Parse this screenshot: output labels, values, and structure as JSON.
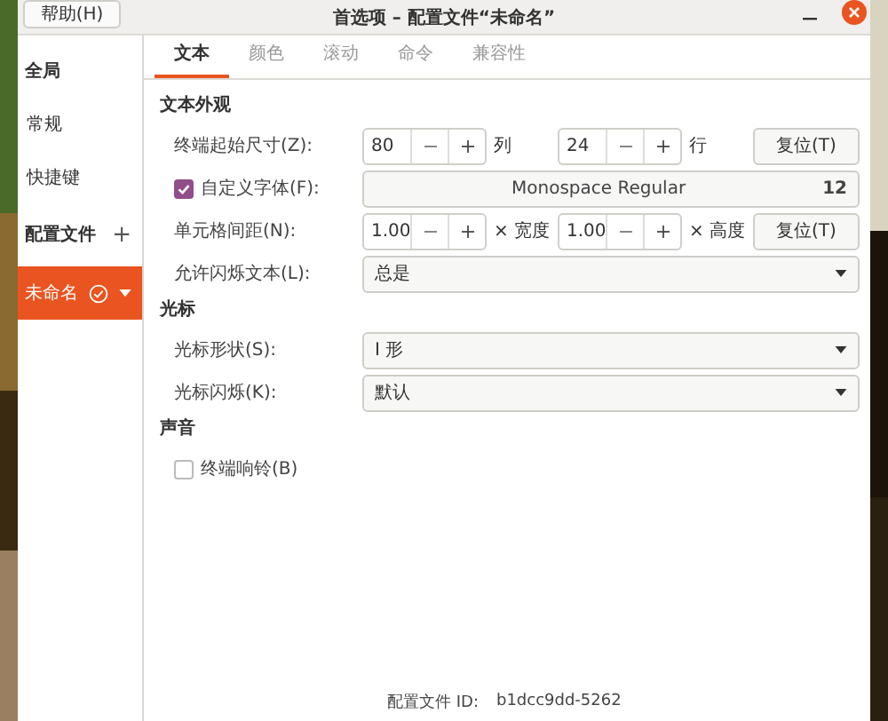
{
  "window": {
    "title": "首选项 – 配置文件“未命名”",
    "help_button": "帮助(H)"
  },
  "sidebar": {
    "items": [
      {
        "kind": "header",
        "label": "全局",
        "selected": false
      },
      {
        "kind": "item",
        "label": "常规",
        "selected": false
      },
      {
        "kind": "item",
        "label": "快捷键",
        "selected": false
      },
      {
        "kind": "header_add",
        "label": "配置文件",
        "add": "+",
        "selected": false
      },
      {
        "kind": "profile",
        "label": "未命名",
        "selected": true
      }
    ]
  },
  "tabs": [
    {
      "label": "文本",
      "selected": true
    },
    {
      "label": "颜色",
      "selected": false
    },
    {
      "label": "滚动",
      "selected": false
    },
    {
      "label": "命令",
      "selected": false
    },
    {
      "label": "兼容性",
      "selected": false
    }
  ],
  "sections": [
    {
      "title": "文本外观",
      "rows": [
        {
          "kind": "size",
          "label": "终端起始尺寸(Z):",
          "a": "80",
          "a_unit": "列",
          "b": "24",
          "b_unit": "行",
          "reset": "复位(T)"
        },
        {
          "kind": "font",
          "label": "自定义字体(F):",
          "checked": true,
          "font": "Monospace Regular",
          "size": "12"
        },
        {
          "kind": "size",
          "label": "单元格间距(N):",
          "a": "1.00",
          "a_unit": "× 宽度",
          "b": "1.00",
          "b_unit": "× 高度",
          "reset": "复位(T)"
        },
        {
          "kind": "select",
          "label": "允许闪烁文本(L):",
          "value": "总是"
        }
      ]
    },
    {
      "title": "光标",
      "rows": [
        {
          "kind": "select",
          "label": "光标形状(S):",
          "value": "I 形"
        },
        {
          "kind": "select",
          "label": "光标闪烁(K):",
          "value": "默认"
        }
      ]
    },
    {
      "title": "声音",
      "rows": [
        {
          "kind": "check",
          "label": "终端响铃(B)",
          "checked": false
        }
      ]
    }
  ],
  "footer": {
    "label": "配置文件 ID:",
    "value": "b1dcc9dd-5262"
  }
}
